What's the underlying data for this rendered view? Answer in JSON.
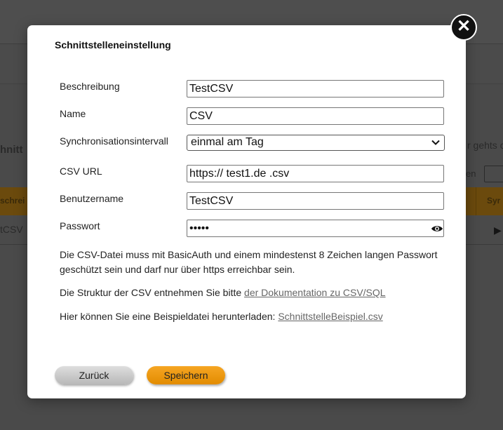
{
  "background": {
    "heading_fragment": "hnitt",
    "right_text_1": "r gehts c",
    "right_text_2": "en",
    "table_header_left": "schrei",
    "table_header_right": "Syr",
    "row_cell": "tCSV"
  },
  "dialog": {
    "title": "Schnittstelleneinstellung",
    "close_icon": "close-icon",
    "fields": {
      "beschreibung": {
        "label": "Beschreibung",
        "value": "TestCSV"
      },
      "name": {
        "label": "Name",
        "value": "CSV"
      },
      "intervall": {
        "label": "Synchronisationsintervall",
        "value": "einmal am Tag"
      },
      "csv_url": {
        "label": "CSV URL",
        "value": "https:// test1.de .csv"
      },
      "benutzername": {
        "label": "Benutzername",
        "value": "TestCSV"
      },
      "passwort": {
        "label": "Passwort",
        "value": "•••••"
      }
    },
    "info": {
      "basic_auth": "Die CSV-Datei muss mit BasicAuth und einem mindestenst 8 Zeichen langen Passwort geschützt sein und darf nur über https erreichbar sein.",
      "structure_text": "Die Struktur der CSV entnehmen Sie bitte ",
      "structure_link": "der Dokumentation zu CSV/SQL",
      "download_text": "Hier können Sie eine Beispieldatei herunterladen: ",
      "download_link": "SchnittstelleBeispiel.csv"
    },
    "buttons": {
      "back": "Zurück",
      "save": "Speichern"
    },
    "colors": {
      "save_button": "#f29a10",
      "back_button": "#c8c8c8",
      "close_button": "#111111"
    }
  }
}
